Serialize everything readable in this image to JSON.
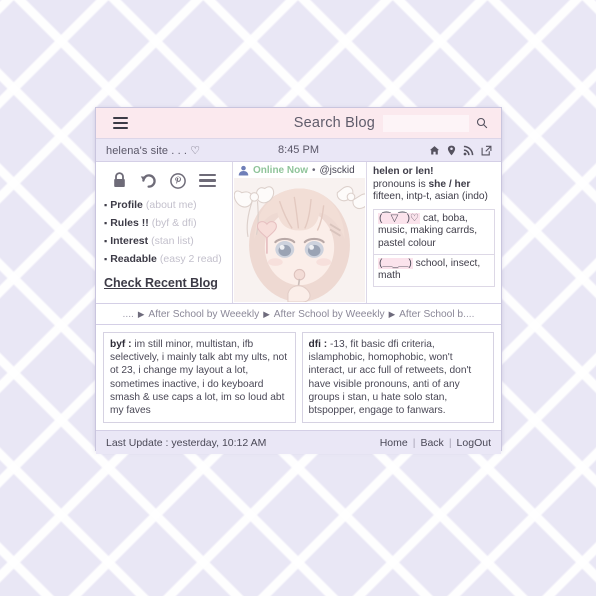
{
  "topbar": {
    "menu_icon": "hamburger-icon",
    "search_label": "Search Blog",
    "search_value": "",
    "search_placeholder": "",
    "search_icon": "search-icon"
  },
  "sitebar": {
    "site_name": "helena's site . . . ♡",
    "clock": "8:45 PM",
    "icons": [
      "home-icon",
      "location-pin-icon",
      "rss-icon",
      "external-link-icon"
    ]
  },
  "sidebar": {
    "icons": [
      "lock-icon",
      "undo-arrow-icon",
      "pinterest-icon",
      "hamburger-icon"
    ],
    "items": [
      {
        "label": "Profile",
        "sub": "(about me)"
      },
      {
        "label": "Rules !!",
        "sub": "(byf & dfi)"
      },
      {
        "label": "Interest",
        "sub": "(stan list)"
      },
      {
        "label": "Readable",
        "sub": "(easy 2 read)"
      }
    ],
    "recent_blog_link": "Check Recent Blog"
  },
  "profile": {
    "status": "Online Now",
    "separator": "•",
    "handle": "@jsckid",
    "avatar_alt": "pastel anime girl portrait",
    "name": "helen or len!",
    "pronouns_prefix": "pronouns is ",
    "pronouns": "she / her",
    "details": "fifteen, intp-t, asian (indo)",
    "likes_emoticon": "(⁀▽⁀)♡",
    "likes": " cat, boba, music, making carrds, pastel colour",
    "dislikes_emoticon": "(＿_＿)",
    "dislikes": " school, insect, math"
  },
  "breadcrumb": {
    "lead_dots": "....",
    "trail_dots": "....",
    "arrow": "▶",
    "items": [
      "After School by Weeekly",
      "After School by Weeekly",
      "After School b"
    ]
  },
  "boxes": [
    {
      "title": "byf :",
      "text": " im still minor, multistan, ifb selectively, i mainly talk abt my ults, not ot 23, i change my layout a lot, sometimes inactive, i do keyboard smash & use caps a lot, im so loud abt my faves"
    },
    {
      "title": "dfi :",
      "text": " -13, fit basic dfi criteria, islamphobic, homophobic, won't interact, ur acc full of retweets, don't have visible pronouns, anti of any groups i stan, u hate solo stan, btspopper, engage to fanwars."
    }
  ],
  "footer": {
    "last_update": "Last Update : yesterday, 10:12 AM",
    "links": [
      "Home",
      "Back",
      "LogOut"
    ],
    "separator": "|"
  },
  "colors": {
    "accent_pink": "#fbe9ee",
    "lavender": "#eae7f6",
    "background": "#e9e7f5",
    "online_green": "#8fc49a",
    "emoticon_pink": "#fbe3ec"
  }
}
